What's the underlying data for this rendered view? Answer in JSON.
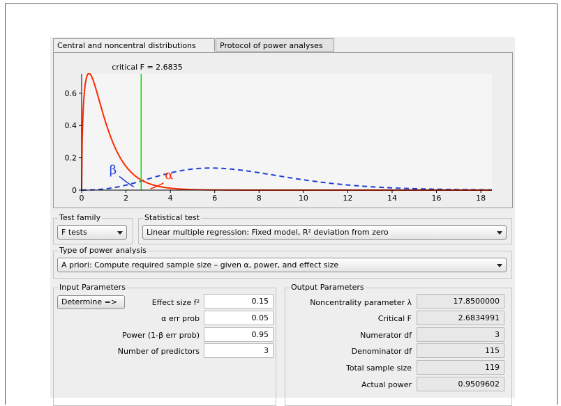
{
  "tabs": [
    {
      "label": "Central and noncentral distributions",
      "active": true
    },
    {
      "label": "Protocol of power analyses",
      "active": false
    }
  ],
  "plot": {
    "critical_label": "critical F = 2.6835",
    "beta_symbol": "β",
    "alpha_symbol": "α",
    "colors": {
      "central": "#ff2a00",
      "noncentral": "#1e3fd6",
      "critical_line": "#00dd00",
      "plot_bg": "#f5f5f5"
    }
  },
  "chart_data": {
    "type": "line",
    "critical_value": 2.6835,
    "xlim": [
      0,
      18.5
    ],
    "ylim": [
      0,
      0.72
    ],
    "x_ticks": [
      0,
      2,
      4,
      6,
      8,
      10,
      12,
      14,
      16,
      18
    ],
    "y_ticks": [
      0,
      0.2,
      0.4,
      0.6
    ],
    "y_tick_labels": [
      "0",
      "0.2",
      "0.4",
      "0.6"
    ],
    "series": [
      {
        "df1": 3,
        "df2": 115,
        "noncentrality": 0
      },
      {
        "df1": 3,
        "df2": 115,
        "noncentrality": 17.85
      }
    ]
  },
  "test_family": {
    "legend": "Test family",
    "value": "F tests"
  },
  "statistical_test": {
    "legend": "Statistical test",
    "value": "Linear multiple regression: Fixed model, R² deviation from zero"
  },
  "power_analysis": {
    "legend": "Type of power analysis",
    "value": "A priori: Compute required sample size – given α, power, and effect size"
  },
  "input": {
    "legend": "Input Parameters",
    "determine_label": "Determine =>",
    "rows": [
      {
        "label": "Effect size f²",
        "value": "0.15"
      },
      {
        "label": "α err prob",
        "value": "0.05"
      },
      {
        "label": "Power (1-β err prob)",
        "value": "0.95"
      },
      {
        "label": "Number of predictors",
        "value": "3"
      }
    ]
  },
  "output": {
    "legend": "Output Parameters",
    "rows": [
      {
        "label": "Noncentrality parameter λ",
        "value": "17.8500000"
      },
      {
        "label": "Critical F",
        "value": "2.6834991"
      },
      {
        "label": "Numerator df",
        "value": "3"
      },
      {
        "label": "Denominator df",
        "value": "115"
      },
      {
        "label": "Total sample size",
        "value": "119"
      },
      {
        "label": "Actual power",
        "value": "0.9509602"
      }
    ]
  }
}
